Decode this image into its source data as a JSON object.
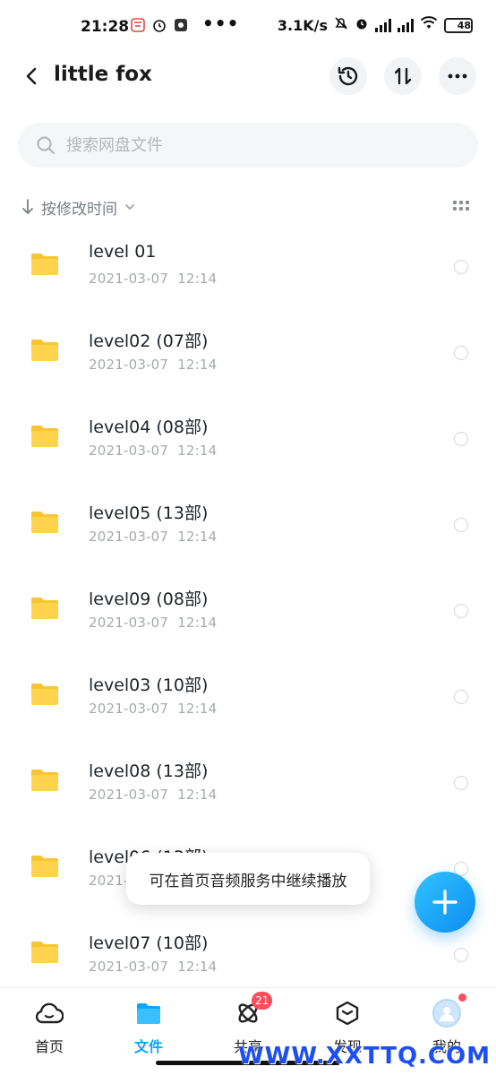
{
  "status_bar": {
    "time": "21:28",
    "dots": "•••",
    "speed": "3.1K/s",
    "battery": "48"
  },
  "header": {
    "title": "little fox"
  },
  "search": {
    "placeholder": "搜索网盘文件",
    "value": ""
  },
  "sort": {
    "label": "按修改时间"
  },
  "files": [
    {
      "name": "level 01",
      "date": "2021-03-07",
      "time": "12:14"
    },
    {
      "name": "level02 (07部)",
      "date": "2021-03-07",
      "time": "12:14"
    },
    {
      "name": "level04 (08部)",
      "date": "2021-03-07",
      "time": "12:14"
    },
    {
      "name": "level05 (13部)",
      "date": "2021-03-07",
      "time": "12:14"
    },
    {
      "name": "level09 (08部)",
      "date": "2021-03-07",
      "time": "12:14"
    },
    {
      "name": "level03 (10部)",
      "date": "2021-03-07",
      "time": "12:14"
    },
    {
      "name": "level08 (13部)",
      "date": "2021-03-07",
      "time": "12:14"
    },
    {
      "name": "level06 (13部)",
      "date": "2021-03-07",
      "time": "12:14"
    },
    {
      "name": "level07 (10部)",
      "date": "2021-03-07",
      "time": "12:14"
    }
  ],
  "toast": "可在首页音频服务中继续播放",
  "bottom_nav": {
    "items": [
      {
        "label": "首页",
        "icon": "cloud-icon"
      },
      {
        "label": "文件",
        "icon": "folder-icon"
      },
      {
        "label": "共享",
        "icon": "share-icon",
        "badge": "21"
      },
      {
        "label": "发现",
        "icon": "cube-icon"
      },
      {
        "label": "我的",
        "icon": "avatar-icon"
      }
    ]
  },
  "watermark": "WWW.XXTTQ.COM",
  "colors": {
    "accent": "#06a7ff",
    "folder": "#ffd34d",
    "badge": "#ff4d5a"
  }
}
